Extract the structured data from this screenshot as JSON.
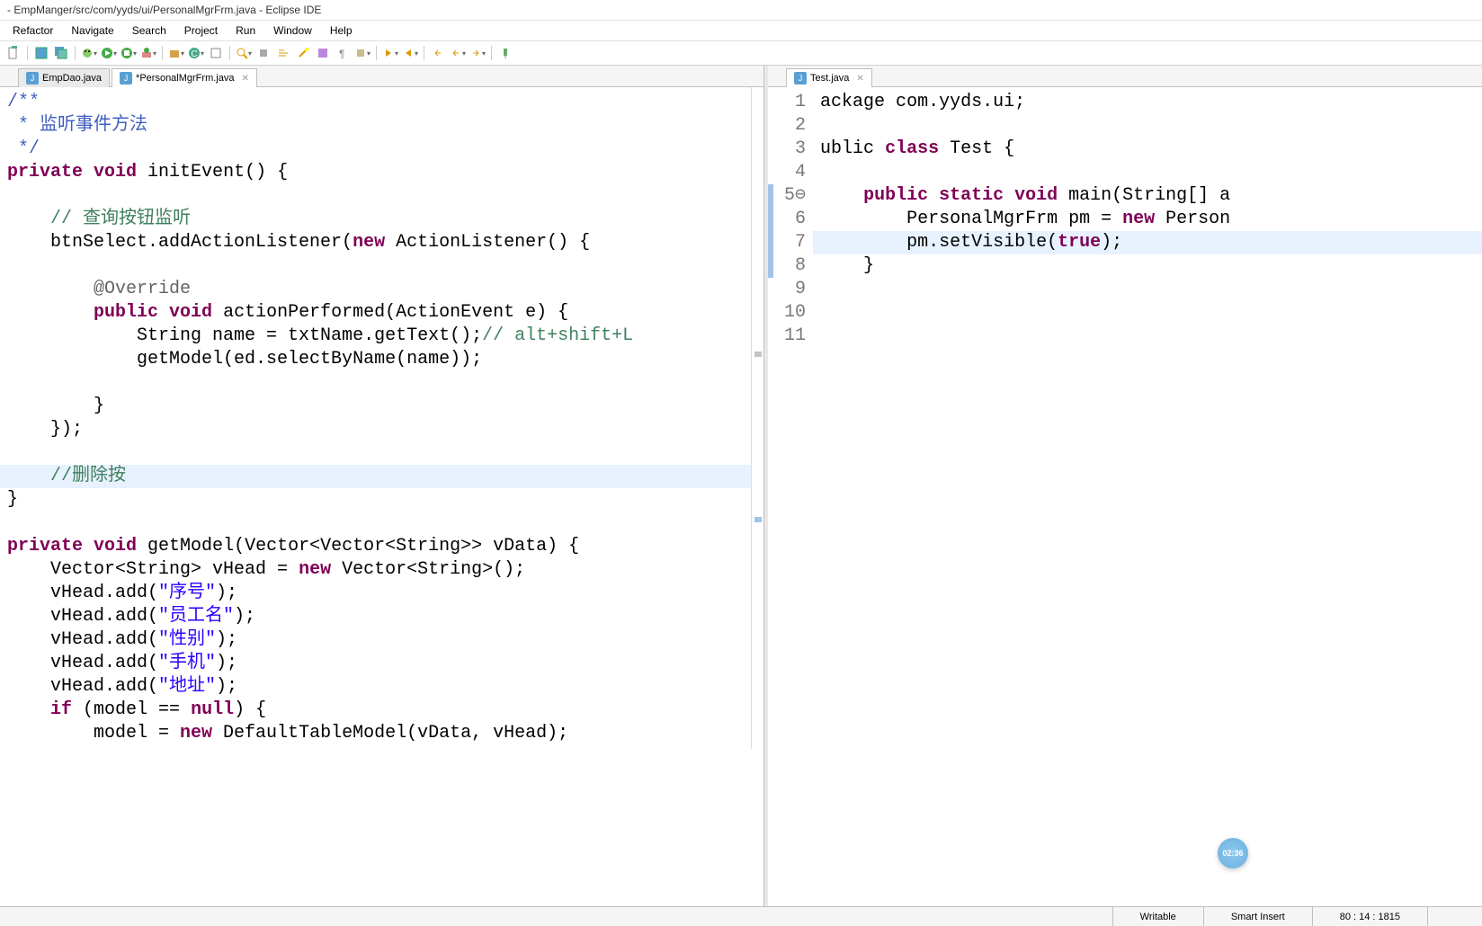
{
  "window": {
    "title": "- EmpManger/src/com/yyds/ui/PersonalMgrFrm.java - Eclipse IDE"
  },
  "menu": {
    "items": [
      "Refactor",
      "Navigate",
      "Search",
      "Project",
      "Run",
      "Window",
      "Help"
    ]
  },
  "tabs": {
    "left": [
      {
        "label": "EmpDao.java",
        "active": false
      },
      {
        "label": "*PersonalMgrFrm.java",
        "active": true
      }
    ],
    "right": [
      {
        "label": "Test.java",
        "active": true
      }
    ]
  },
  "left_code": {
    "lines": [
      {
        "html": "<span class='jd'>/**</span>"
      },
      {
        "html": "<span class='jd'> * 监听事件方法</span>"
      },
      {
        "html": "<span class='jd'> */</span>"
      },
      {
        "html": "<span class='kw'>private</span> <span class='kw'>void</span> initEvent() {"
      },
      {
        "html": ""
      },
      {
        "html": "    <span class='cm'>// 查询按钮监听</span>"
      },
      {
        "html": "    btnSelect.addActionListener(<span class='kw'>new</span> ActionListener() {"
      },
      {
        "html": ""
      },
      {
        "html": "        <span class='an'>@Override</span>"
      },
      {
        "html": "        <span class='kw'>public</span> <span class='kw'>void</span> actionPerformed(ActionEvent e) {"
      },
      {
        "html": "            String name = txtName.getText();<span class='cm'>// alt+shift+L</span>"
      },
      {
        "html": "            getModel(ed.selectByName(name));"
      },
      {
        "html": ""
      },
      {
        "html": "        }"
      },
      {
        "html": "    });"
      },
      {
        "html": ""
      },
      {
        "html": "    <span class='cm'>//删除按</span>",
        "highlight": true
      },
      {
        "html": "}"
      },
      {
        "html": ""
      },
      {
        "html": "<span class='kw'>private</span> <span class='kw'>void</span> getModel(Vector&lt;Vector&lt;String&gt;&gt; vData) {"
      },
      {
        "html": "    Vector&lt;String&gt; vHead = <span class='kw'>new</span> Vector&lt;String&gt;();"
      },
      {
        "html": "    vHead.add(<span class='st'>\"序号\"</span>);"
      },
      {
        "html": "    vHead.add(<span class='st'>\"员工名\"</span>);"
      },
      {
        "html": "    vHead.add(<span class='st'>\"性别\"</span>);"
      },
      {
        "html": "    vHead.add(<span class='st'>\"手机\"</span>);"
      },
      {
        "html": "    vHead.add(<span class='st'>\"地址\"</span>);"
      },
      {
        "html": "    <span class='kw'>if</span> (model == <span class='kw'>null</span>) {"
      },
      {
        "html": "        model = <span class='kw'>new</span> DefaultTableModel(vData, vHead);"
      }
    ]
  },
  "right_code": {
    "lines": [
      {
        "n": "1",
        "html": "ackage com.yyds.ui;"
      },
      {
        "n": "2",
        "html": ""
      },
      {
        "n": "3",
        "html": "ublic <span class='kw'>class</span> Test {"
      },
      {
        "n": "4",
        "html": ""
      },
      {
        "n": "5⊖",
        "html": "    <span class='kw'>public</span> <span class='kw'>static</span> <span class='kw'>void</span> main(String[] a",
        "change": true
      },
      {
        "n": "6",
        "html": "        PersonalMgrFrm pm = <span class='kw'>new</span> Person",
        "change": true
      },
      {
        "n": "7",
        "html": "        pm.setVisible(<span class='kw'>true</span>);",
        "highlight": true,
        "change": true
      },
      {
        "n": "8",
        "html": "    }",
        "change": true
      },
      {
        "n": "9",
        "html": ""
      },
      {
        "n": "10",
        "html": ""
      },
      {
        "n": "11",
        "html": ""
      }
    ]
  },
  "status": {
    "writable": "Writable",
    "insert": "Smart Insert",
    "position": "80 : 14 : 1815"
  },
  "timer": {
    "value": "02:36"
  }
}
